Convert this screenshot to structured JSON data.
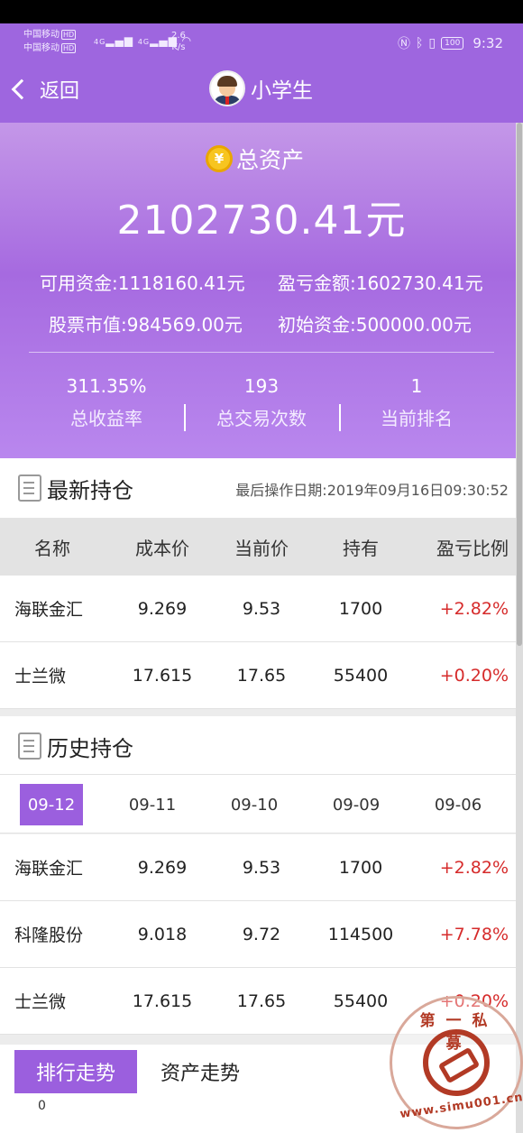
{
  "status_bar": {
    "carrier_1": "中国移动",
    "carrier_2": "中国移动",
    "hd_badge": "HD",
    "net_1": "4G",
    "net_2": "4G",
    "speed_value": "2.6",
    "speed_unit": "K/s",
    "battery": "100",
    "time": "9:32"
  },
  "nav": {
    "back_label": "返回",
    "title": "小学生"
  },
  "summary": {
    "asset_label": "总资产",
    "coin_symbol": "¥",
    "total_assets": "2102730.41元",
    "available_funds": "可用资金:1118160.41元",
    "profit_loss_amount": "盈亏金额:1602730.41元",
    "stock_value": "股票市值:984569.00元",
    "initial_funds": "初始资金:500000.00元",
    "stats": [
      {
        "value": "311.35%",
        "label": "总收益率"
      },
      {
        "value": "193",
        "label": "总交易次数"
      },
      {
        "value": "1",
        "label": "当前排名"
      }
    ]
  },
  "latest_holdings": {
    "title": "最新持仓",
    "last_op_date": "最后操作日期:2019年09月16日09:30:52",
    "columns": [
      "名称",
      "成本价",
      "当前价",
      "持有",
      "盈亏比例"
    ],
    "rows": [
      {
        "name": "海联金汇",
        "cost": "9.269",
        "price": "9.53",
        "hold": "1700",
        "ratio": "+2.82%"
      },
      {
        "name": "士兰微",
        "cost": "17.615",
        "price": "17.65",
        "hold": "55400",
        "ratio": "+0.20%"
      }
    ]
  },
  "history_holdings": {
    "title": "历史持仓",
    "dates": [
      "09-12",
      "09-11",
      "09-10",
      "09-09",
      "09-06"
    ],
    "active_date_index": 0,
    "rows": [
      {
        "name": "海联金汇",
        "cost": "9.269",
        "price": "9.53",
        "hold": "1700",
        "ratio": "+2.82%"
      },
      {
        "name": "科隆股份",
        "cost": "9.018",
        "price": "9.72",
        "hold": "114500",
        "ratio": "+7.78%"
      },
      {
        "name": "士兰微",
        "cost": "17.615",
        "price": "17.65",
        "hold": "55400",
        "ratio": "+0.20%"
      }
    ]
  },
  "tabs": {
    "items": [
      "排行走势",
      "资产走势"
    ],
    "active_index": 0,
    "chart_first_tick": "0"
  },
  "watermark": {
    "top_text": "第一私募",
    "bottom_text": "www.simu001.cn"
  },
  "colors": {
    "accent": "#9b5fde",
    "header": "#9e66df",
    "positive": "#d62b2b"
  }
}
